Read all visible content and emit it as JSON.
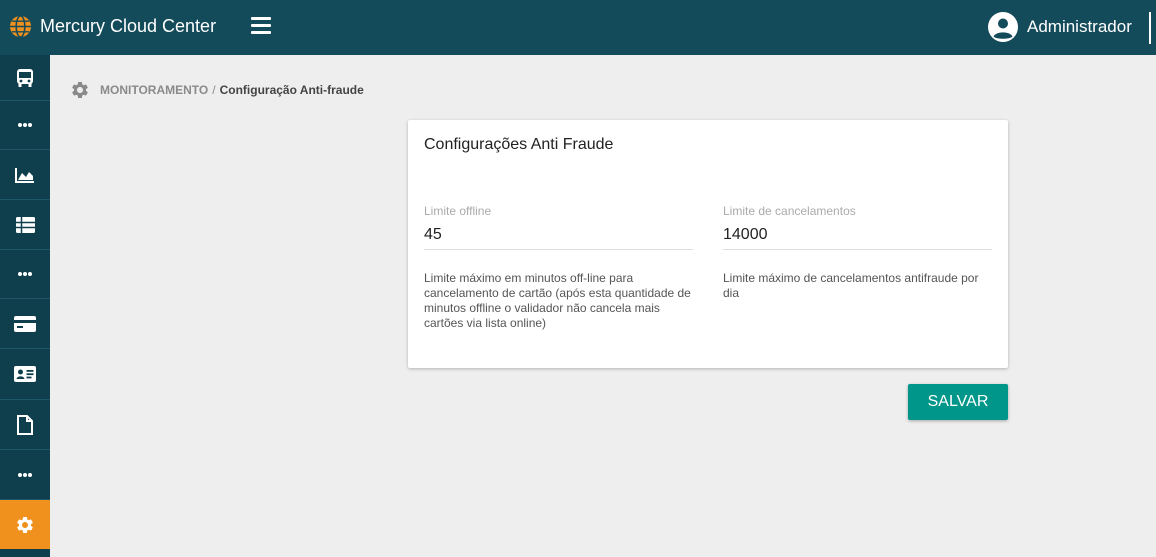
{
  "app": {
    "title": "Mercury Cloud Center"
  },
  "user": {
    "name": "Administrador"
  },
  "colors": {
    "topbar": "#144b5b",
    "sidebar": "#0f3f4d",
    "active": "#f0901d",
    "primary_button": "#00968a"
  },
  "sidebar": {
    "items": [
      {
        "icon": "bus-icon",
        "active": false
      },
      {
        "icon": "more-icon",
        "active": false
      },
      {
        "icon": "area-chart-icon",
        "active": false
      },
      {
        "icon": "table-icon",
        "active": false
      },
      {
        "icon": "more-icon",
        "active": false
      },
      {
        "icon": "credit-card-icon",
        "active": false
      },
      {
        "icon": "id-card-icon",
        "active": false
      },
      {
        "icon": "file-icon",
        "active": false
      },
      {
        "icon": "more-icon",
        "active": false
      },
      {
        "icon": "gear-icon",
        "active": true
      }
    ]
  },
  "breadcrumb": {
    "parent": "MONITORAMENTO",
    "separator": "/",
    "current": "Configuração Anti-fraude"
  },
  "card": {
    "title": "Configurações Anti Fraude",
    "fields": [
      {
        "label": "Limite offline",
        "value": "45",
        "help": "Limite máximo em minutos off-line para cancelamento de cartão (após esta quantidade de minutos offline o validador não cancela mais cartões via lista online)"
      },
      {
        "label": "Limite de cancelamentos",
        "value": "14000",
        "help": "Limite máximo de cancelamentos antifraude por dia"
      }
    ]
  },
  "actions": {
    "save_label": "SALVAR"
  }
}
